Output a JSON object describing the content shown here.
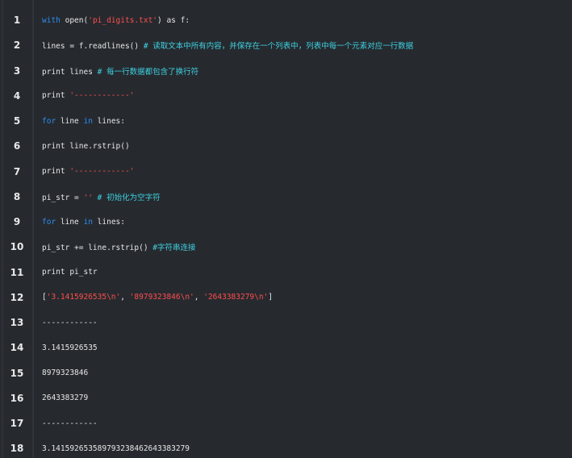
{
  "lines": [
    {
      "num": "1",
      "tokens": [
        {
          "t": "kw",
          "v": "with"
        },
        {
          "t": "plain",
          "v": " open("
        },
        {
          "t": "str",
          "v": "'pi_digits.txt'"
        },
        {
          "t": "plain",
          "v": ") as f:"
        }
      ]
    },
    {
      "num": "2",
      "tokens": [
        {
          "t": "plain",
          "v": "lines = f.readlines() "
        },
        {
          "t": "cm",
          "v": "# 读取文本中所有内容，并保存在一个列表中，列表中每一个元素对应一行数据"
        }
      ]
    },
    {
      "num": "3",
      "tokens": [
        {
          "t": "plain",
          "v": "print lines "
        },
        {
          "t": "cm",
          "v": "# 每一行数据都包含了换行符"
        }
      ]
    },
    {
      "num": "4",
      "tokens": [
        {
          "t": "plain",
          "v": "print "
        },
        {
          "t": "str",
          "v": "'------------'"
        }
      ]
    },
    {
      "num": "5",
      "tokens": [
        {
          "t": "kw",
          "v": "for"
        },
        {
          "t": "plain",
          "v": " line "
        },
        {
          "t": "kw",
          "v": "in"
        },
        {
          "t": "plain",
          "v": " lines:"
        }
      ]
    },
    {
      "num": "6",
      "tokens": [
        {
          "t": "plain",
          "v": "print line.rstrip()"
        }
      ]
    },
    {
      "num": "7",
      "tokens": [
        {
          "t": "plain",
          "v": "print "
        },
        {
          "t": "str",
          "v": "'------------'"
        }
      ]
    },
    {
      "num": "8",
      "tokens": [
        {
          "t": "plain",
          "v": "pi_str = "
        },
        {
          "t": "str",
          "v": "''"
        },
        {
          "t": "plain",
          "v": " "
        },
        {
          "t": "cm",
          "v": "# 初始化为空字符"
        }
      ]
    },
    {
      "num": "9",
      "tokens": [
        {
          "t": "kw",
          "v": "for"
        },
        {
          "t": "plain",
          "v": " line "
        },
        {
          "t": "kw",
          "v": "in"
        },
        {
          "t": "plain",
          "v": " lines:"
        }
      ]
    },
    {
      "num": "10",
      "tokens": [
        {
          "t": "plain",
          "v": "pi_str += line.rstrip() "
        },
        {
          "t": "cm",
          "v": "#字符串连接"
        }
      ]
    },
    {
      "num": "11",
      "tokens": [
        {
          "t": "plain",
          "v": "print pi_str"
        }
      ]
    },
    {
      "num": "12",
      "tokens": [
        {
          "t": "plain",
          "v": "["
        },
        {
          "t": "str",
          "v": "'3.1415926535\\n'"
        },
        {
          "t": "plain",
          "v": ", "
        },
        {
          "t": "str",
          "v": "'8979323846\\n'"
        },
        {
          "t": "plain",
          "v": ", "
        },
        {
          "t": "str",
          "v": "'2643383279\\n'"
        },
        {
          "t": "plain",
          "v": "]"
        }
      ]
    },
    {
      "num": "13",
      "tokens": [
        {
          "t": "plain",
          "v": "------------"
        }
      ]
    },
    {
      "num": "14",
      "tokens": [
        {
          "t": "plain",
          "v": "3.1415926535"
        }
      ]
    },
    {
      "num": "15",
      "tokens": [
        {
          "t": "plain",
          "v": "8979323846"
        }
      ]
    },
    {
      "num": "16",
      "tokens": [
        {
          "t": "plain",
          "v": "2643383279"
        }
      ]
    },
    {
      "num": "17",
      "tokens": [
        {
          "t": "plain",
          "v": "------------"
        }
      ]
    },
    {
      "num": "18",
      "tokens": [
        {
          "t": "plain",
          "v": "3.141592653589793238462643383279"
        }
      ]
    }
  ],
  "colors": {
    "background": "#262a2f",
    "keyword": "#2e8cf0",
    "string": "#ff4d4d",
    "comment": "#3fd0e0",
    "text": "#e6e6e6"
  }
}
